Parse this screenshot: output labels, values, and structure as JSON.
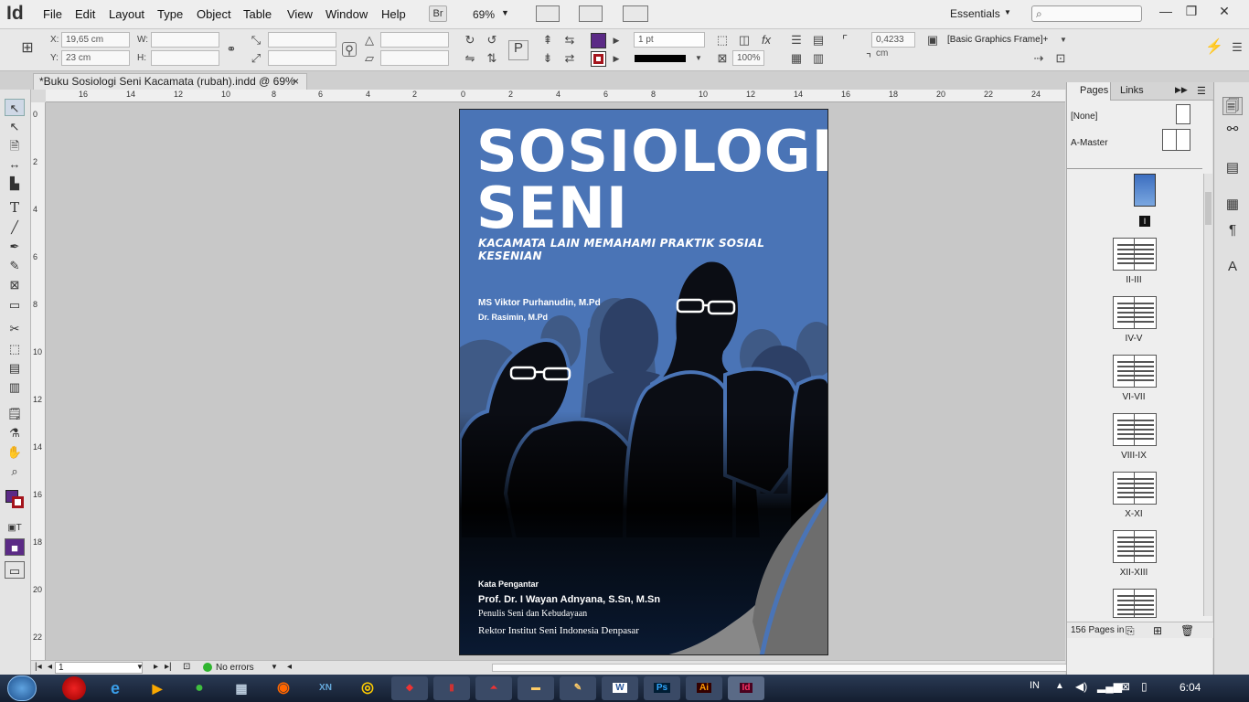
{
  "app": {
    "logo": "Id",
    "menus": [
      "File",
      "Edit",
      "Layout",
      "Type",
      "Object",
      "Table",
      "View",
      "Window",
      "Help"
    ],
    "bridge_label": "Br",
    "zoom_value": "69%",
    "workspace": "Essentials",
    "search_placeholder": ""
  },
  "control": {
    "x_label": "X:",
    "x_value": "19,65 cm",
    "y_label": "Y:",
    "y_value": "23 cm",
    "w_label": "W:",
    "h_label": "H:",
    "stroke_weight": "1 pt",
    "ref_value": "0,4233 cm",
    "scale_value": "100%",
    "frame_style": "[Basic Graphics Frame]+",
    "fill_color": "#5b2a86",
    "stroke_color": "#a4141c"
  },
  "document": {
    "tab_title": "*Buku Sosiologi Seni Kacamata (rubah).indd @ 69%",
    "tab_close": "×"
  },
  "rulers": {
    "horizontal": [
      "16",
      "14",
      "12",
      "10",
      "8",
      "6",
      "4",
      "2",
      "0",
      "2",
      "4",
      "6",
      "8",
      "10",
      "12",
      "14",
      "16",
      "18",
      "20",
      "22",
      "24"
    ],
    "vertical": [
      "0",
      "2",
      "4",
      "6",
      "8",
      "10",
      "12",
      "14",
      "16",
      "18",
      "20",
      "22"
    ]
  },
  "cover": {
    "title_line1": "SOSIOLOGI",
    "title_line2": "SENI",
    "subtitle": "KACAMATA LAIN MEMAHAMI PRAKTIK SOSIAL KESENIAN",
    "author1": "MS Viktor Purhanudin, M.Pd",
    "author2": "Dr. Rasimin, M.Pd",
    "foreword_label": "Kata Pengantar",
    "foreword_name": "Prof. Dr. I Wayan Adnyana, S.Sn, M.Sn",
    "foreword_role1": "Penulis Seni dan Kebudayaan",
    "foreword_role2": "Rektor Institut Seni Indonesia Denpasar",
    "bg_color": "#4a74b6"
  },
  "status": {
    "page_field": "1",
    "preflight": "No errors"
  },
  "pages_panel": {
    "tabs": [
      "Pages",
      "Links"
    ],
    "masters": [
      "[None]",
      "A-Master"
    ],
    "first_page_label": "I",
    "spreads": [
      "II-III",
      "IV-V",
      "VI-VII",
      "VIII-IX",
      "X-XI",
      "XII-XIII"
    ],
    "footer": "156 Pages in"
  },
  "taskbar": {
    "lang": "IN",
    "time": "6:04",
    "apps": [
      "opera",
      "ie",
      "media",
      "chrome-alt",
      "calc",
      "firefox",
      "xnview",
      "chrome",
      "reader",
      "winrar",
      "acrobat",
      "explorer",
      "tool",
      "word",
      "photoshop",
      "illustrator",
      "indesign"
    ],
    "app_labels": {
      "word": "W",
      "photoshop": "Ps",
      "illustrator": "Ai",
      "indesign": "Id"
    }
  }
}
